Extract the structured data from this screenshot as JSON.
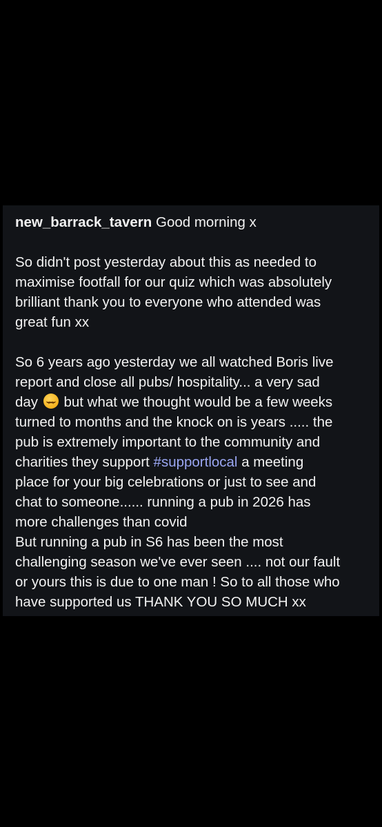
{
  "post": {
    "username": "new_barrack_tavern",
    "greeting": " Good morning x",
    "para1": [
      "So didn't post yesterday about this as needed to",
      "maximise footfall for our quiz which was absolutely",
      "brilliant thank you to everyone who attended was",
      "great fun xx"
    ],
    "para2": {
      "line1": "So 6 years ago yesterday we all watched Boris live",
      "line2": "report and close all pubs/ hospitality... a very sad",
      "line3_before_emoji": "day ",
      "emoji": "disappointed-face-emoji",
      "line3_after_emoji": "  but what we thought would be a few weeks",
      "line4": "turned to months and the knock on is years ..... the",
      "line5": "pub is extremely important to the community and",
      "line6_before_tag": "charities they support ",
      "hashtag": "#supportlocal",
      "line6_after_tag": " a meeting",
      "line7": "place for your big celebrations or just to see and",
      "line8": "chat to someone...... running a pub in 2026 has",
      "line9": "more challenges than covid",
      "line10": "But running a pub in S6 has been the most",
      "line11": "challenging season we've ever seen .... not our fault",
      "line12": "or yours this is due to one man ! So to all those who",
      "line13": "have supported us THANK YOU SO MUCH  xx"
    }
  },
  "colors": {
    "background": "#000000",
    "card": "#121418",
    "text": "#f2f2f2",
    "hashtag": "#9aa6f2"
  }
}
